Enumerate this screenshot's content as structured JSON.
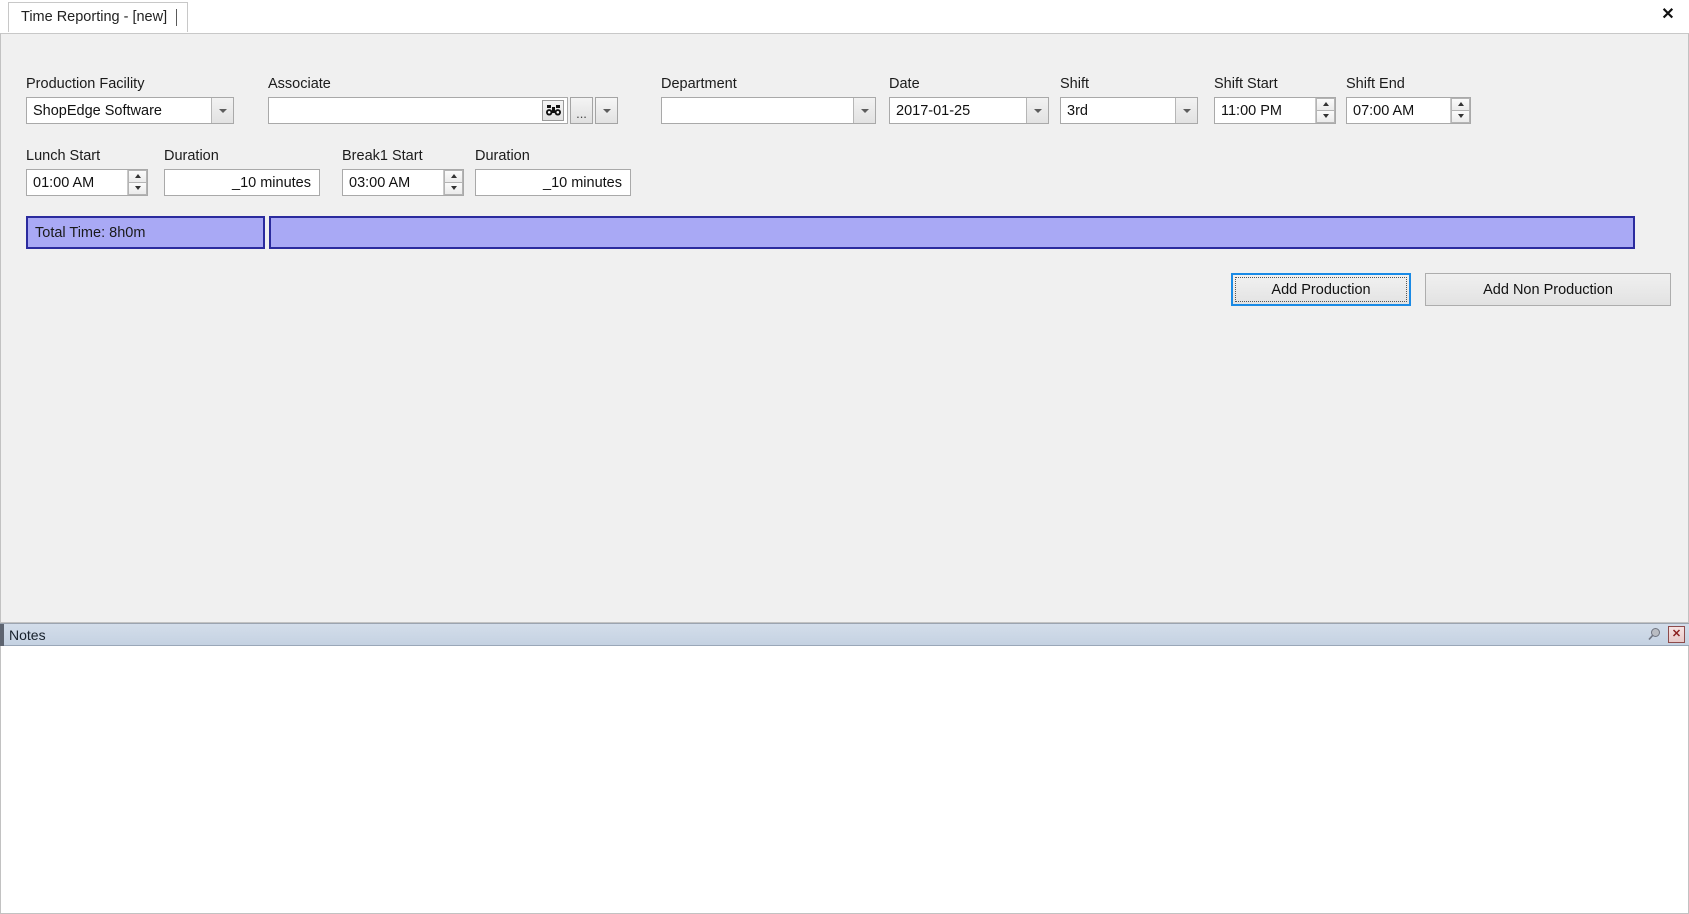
{
  "window": {
    "tab_label": "Time Reporting - [new]",
    "close_label": "✕"
  },
  "form": {
    "production_facility": {
      "label": "Production Facility",
      "value": "ShopEdge Software"
    },
    "associate": {
      "label": "Associate",
      "value": "",
      "placeholder": "",
      "search_icon": "binoculars-icon",
      "ellipsis_label": "..."
    },
    "department": {
      "label": "Department",
      "value": ""
    },
    "date": {
      "label": "Date",
      "value": "2017-01-25"
    },
    "shift": {
      "label": "Shift",
      "value": "3rd"
    },
    "shift_start": {
      "label": "Shift Start",
      "value": "11:00 PM"
    },
    "shift_end": {
      "label": "Shift End",
      "value": "07:00 AM"
    },
    "lunch_start": {
      "label": "Lunch Start",
      "value": "01:00 AM"
    },
    "lunch_duration": {
      "label": "Duration",
      "value": "_10 minutes"
    },
    "break1_start": {
      "label": "Break1 Start",
      "value": "03:00 AM"
    },
    "break1_duration": {
      "label": "Duration",
      "value": "_10 minutes"
    }
  },
  "summary": {
    "total_time": "Total Time: 8h0m",
    "bar_fill_color": "#a9a9f5",
    "bar_border_color": "#2b2b9e"
  },
  "actions": {
    "add_production": "Add Production",
    "add_non_production": "Add Non Production",
    "focus_color": "#1a8ae5"
  },
  "notes": {
    "title": "Notes",
    "content": "",
    "pin_icon": "pin-icon",
    "close_label": "✕"
  }
}
